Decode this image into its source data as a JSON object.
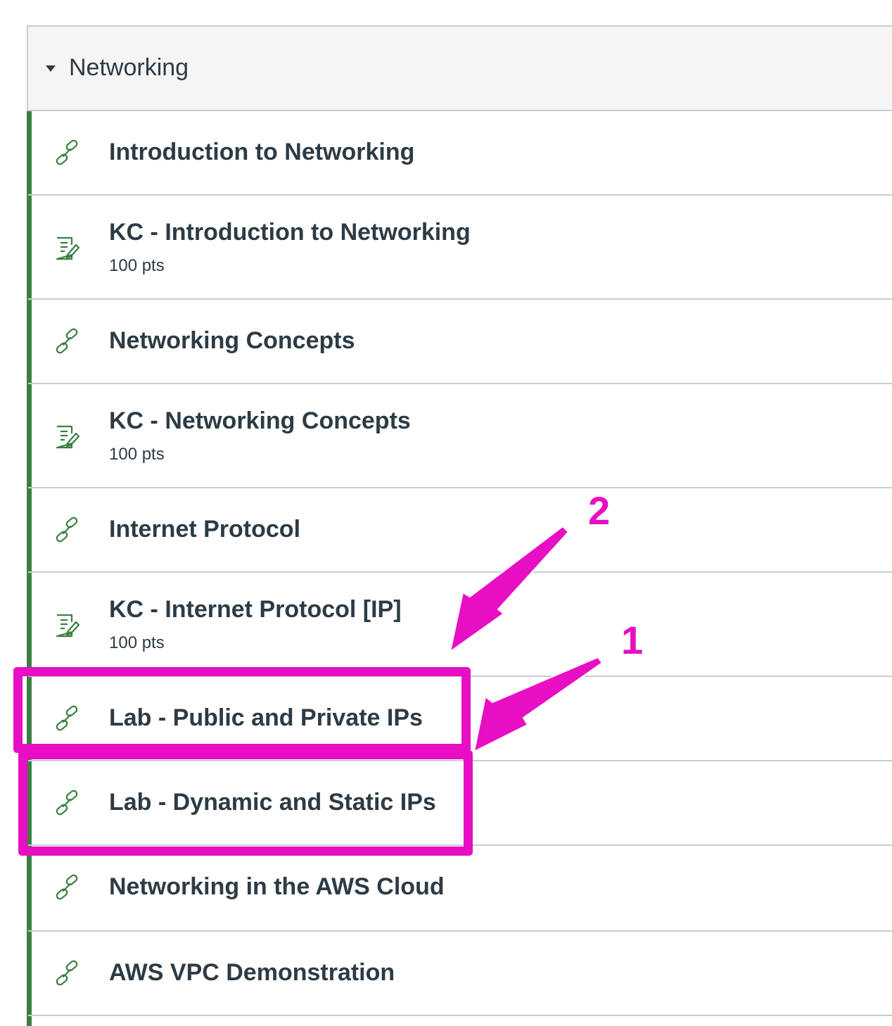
{
  "module": {
    "title": "Networking",
    "toggle_icon": "caret-down-icon",
    "accent_color": "#3b7f43"
  },
  "items": [
    {
      "type": "link",
      "icon": "link-icon",
      "title": "Introduction to Networking"
    },
    {
      "type": "quiz",
      "icon": "quiz-icon",
      "title": "KC - Introduction to Networking",
      "points": "100 pts"
    },
    {
      "type": "link",
      "icon": "link-icon",
      "title": "Networking Concepts"
    },
    {
      "type": "quiz",
      "icon": "quiz-icon",
      "title": "KC - Networking Concepts",
      "points": "100 pts"
    },
    {
      "type": "link",
      "icon": "link-icon",
      "title": "Internet Protocol"
    },
    {
      "type": "quiz",
      "icon": "quiz-icon",
      "title": "KC - Internet Protocol [IP]",
      "points": "100 pts"
    },
    {
      "type": "link",
      "icon": "link-icon",
      "title": "Lab - Public and Private IPs"
    },
    {
      "type": "link",
      "icon": "link-icon",
      "title": "Lab - Dynamic and Static IPs"
    },
    {
      "type": "link",
      "icon": "link-icon",
      "title": "Networking in the AWS Cloud"
    },
    {
      "type": "link",
      "icon": "link-icon",
      "title": "AWS VPC Demonstration"
    }
  ],
  "annotations": {
    "color": "#e70ec4",
    "callout_1": "1",
    "callout_2": "2"
  }
}
